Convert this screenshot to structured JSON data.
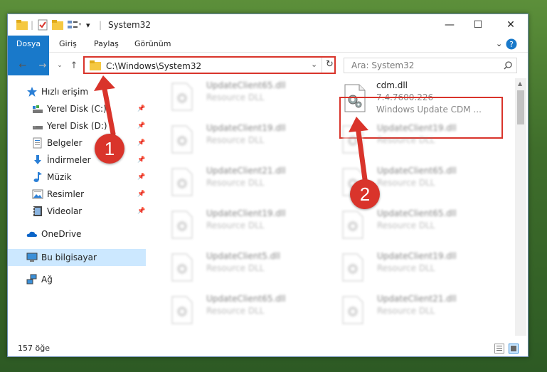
{
  "window": {
    "title": "System32"
  },
  "ribbon": {
    "tabs": [
      "Dosya",
      "Giriş",
      "Paylaş",
      "Görünüm"
    ]
  },
  "navbar": {
    "address": "C:\\Windows\\System32",
    "search_placeholder": "Ara: System32"
  },
  "sidebar": {
    "items": [
      {
        "label": "Hızlı erişim",
        "icon": "star-icon"
      },
      {
        "label": "Yerel Disk (C:)",
        "icon": "drive-icon",
        "pinned": true
      },
      {
        "label": "Yerel Disk (D:)",
        "icon": "drive-icon",
        "pinned": true
      },
      {
        "label": "Belgeler",
        "icon": "documents-icon",
        "pinned": true
      },
      {
        "label": "İndirmeler",
        "icon": "download-icon",
        "pinned": true
      },
      {
        "label": "Müzik",
        "icon": "music-icon",
        "pinned": true
      },
      {
        "label": "Resimler",
        "icon": "pictures-icon",
        "pinned": true
      },
      {
        "label": "Videolar",
        "icon": "video-icon",
        "pinned": true
      },
      {
        "label": "OneDrive",
        "icon": "cloud-icon"
      },
      {
        "label": "Bu bilgisayar",
        "icon": "computer-icon",
        "selected": true
      },
      {
        "label": "Ağ",
        "icon": "network-icon"
      }
    ]
  },
  "files": {
    "highlighted": {
      "name": "cdm.dll",
      "version": "7.4.7600.226",
      "description": "Windows Update CDM ..."
    },
    "left_column": [
      {
        "name": "UpdateClient65.dll",
        "desc": "Resource DLL"
      },
      {
        "name": "UpdateClient19.dll",
        "desc": "Resource DLL"
      },
      {
        "name": "UpdateClient21.dll",
        "desc": "Resource DLL"
      },
      {
        "name": "UpdateClient19.dll",
        "desc": "Resource DLL"
      },
      {
        "name": "UpdateClient5.dll",
        "desc": "Resource DLL"
      },
      {
        "name": "UpdateClient65.dll",
        "desc": "Resource DLL"
      }
    ],
    "right_column": [
      {
        "name": "UpdateClient19.dll",
        "desc": "Resource DLL"
      },
      {
        "name": "UpdateClient65.dll",
        "desc": "Resource DLL"
      },
      {
        "name": "UpdateClient65.dll",
        "desc": "Resource DLL"
      },
      {
        "name": "UpdateClient19.dll",
        "desc": "Resource DLL"
      },
      {
        "name": "UpdateClient21.dll",
        "desc": "Resource DLL"
      }
    ]
  },
  "status": {
    "count": "157 öğe"
  },
  "annotations": {
    "step1": "1",
    "step2": "2"
  },
  "colors": {
    "accent": "#1979ca",
    "highlight": "#d9342b",
    "selected": "#cce8ff"
  }
}
